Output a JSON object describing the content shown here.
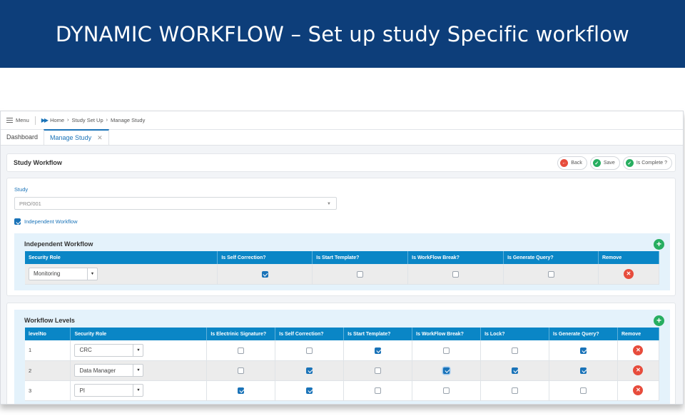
{
  "banner": {
    "title": "DYNAMIC WORKFLOW – Set up study Specific workflow"
  },
  "topbar": {
    "menu_label": "Menu",
    "breadcrumb": [
      "Home",
      "Study Set Up",
      "Manage Study"
    ]
  },
  "tabs": [
    {
      "label": "Dashboard"
    },
    {
      "label": "Manage Study"
    }
  ],
  "header": {
    "title": "Study Workflow",
    "back_label": "Back",
    "save_label": "Save",
    "complete_label": "Is Complete ?"
  },
  "study": {
    "label": "Study",
    "value": "PRO/001",
    "independent_label": "Independent Workflow",
    "independent_checked": true
  },
  "independent": {
    "title": "Independent Workflow",
    "columns": [
      "Security Role",
      "Is Self Correction?",
      "Is Start Template?",
      "Is WorkFlow Break?",
      "Is Generate Query?",
      "Remove"
    ],
    "rows": [
      {
        "role": "Monitoring",
        "self_correction": true,
        "start_template": false,
        "workflow_break": false,
        "generate_query": false
      }
    ]
  },
  "levels": {
    "title": "Workflow Levels",
    "columns": [
      "levelNo",
      "Security Role",
      "Is Electrinic Signature?",
      "Is Self Correction?",
      "Is Start Template?",
      "Is WorkFlow Break?",
      "Is Lock?",
      "Is Generate Query?",
      "Remove"
    ],
    "rows": [
      {
        "level": "1",
        "role": "CRC",
        "esign": false,
        "self_correction": false,
        "start_template": true,
        "workflow_break": false,
        "lock": false,
        "generate_query": true
      },
      {
        "level": "2",
        "role": "Data Manager",
        "esign": false,
        "self_correction": true,
        "start_template": false,
        "workflow_break": true,
        "lock": true,
        "generate_query": true
      },
      {
        "level": "3",
        "role": "PI",
        "esign": true,
        "self_correction": true,
        "start_template": false,
        "workflow_break": false,
        "lock": false,
        "generate_query": false
      }
    ]
  },
  "icons": {
    "add": "plus-icon",
    "remove": "close-icon",
    "back": "arrow-left-icon",
    "save": "check-icon",
    "complete": "check-icon"
  }
}
